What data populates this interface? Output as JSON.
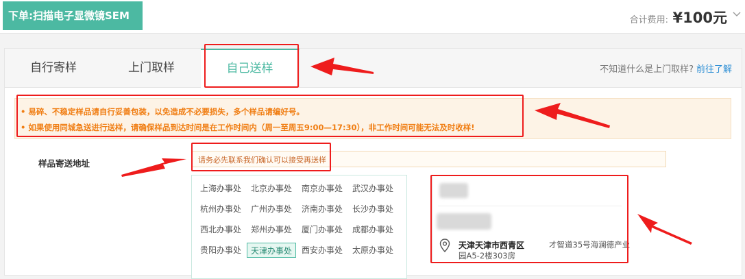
{
  "header": {
    "order_title": "下单:扫描电子显微镜SEM",
    "fee_label": "合计费用:",
    "fee_value": "¥100元"
  },
  "tabs": [
    {
      "label": "自行寄样",
      "active": false
    },
    {
      "label": "上门取样",
      "active": false
    },
    {
      "label": "自己送样",
      "active": true
    }
  ],
  "help": {
    "text": "不知道什么是上门取样?",
    "link": "前往了解"
  },
  "notice": {
    "line1": "• 易碎、不稳定样品请自行妥善包装，以免造成不必要损失，多个样品请编好号。",
    "line2": "• 如果使用同城急送进行送样，请确保样品到达时间是在工作时间内（周一至周五9:00—17:30），非工作时间可能无法及时收样!"
  },
  "address": {
    "label": "样品寄送地址",
    "placeholder": "请务必先联系我们确认可以接受再送样"
  },
  "offices": [
    "上海办事处",
    "北京办事处",
    "南京办事处",
    "武汉办事处",
    "杭州办事处",
    "广州办事处",
    "济南办事处",
    "长沙办事处",
    "西北办事处",
    "郑州办事处",
    "厦门办事处",
    "成都办事处",
    "贵阳办事处",
    "天津办事处",
    "西安办事处",
    "太原办事处"
  ],
  "selected_office": "天津办事处",
  "address_card": {
    "city": "天津天津市西青区",
    "street": "才智道35号海澜德产业",
    "line2": "园A5-2楼303房"
  },
  "colors": {
    "accent": "#4cb9a2",
    "notice_text": "#f07d12",
    "annotation": "#ee1c1c",
    "link": "#2a8dd4"
  },
  "icons": [
    "chevron-down-icon",
    "location-pin-icon"
  ]
}
